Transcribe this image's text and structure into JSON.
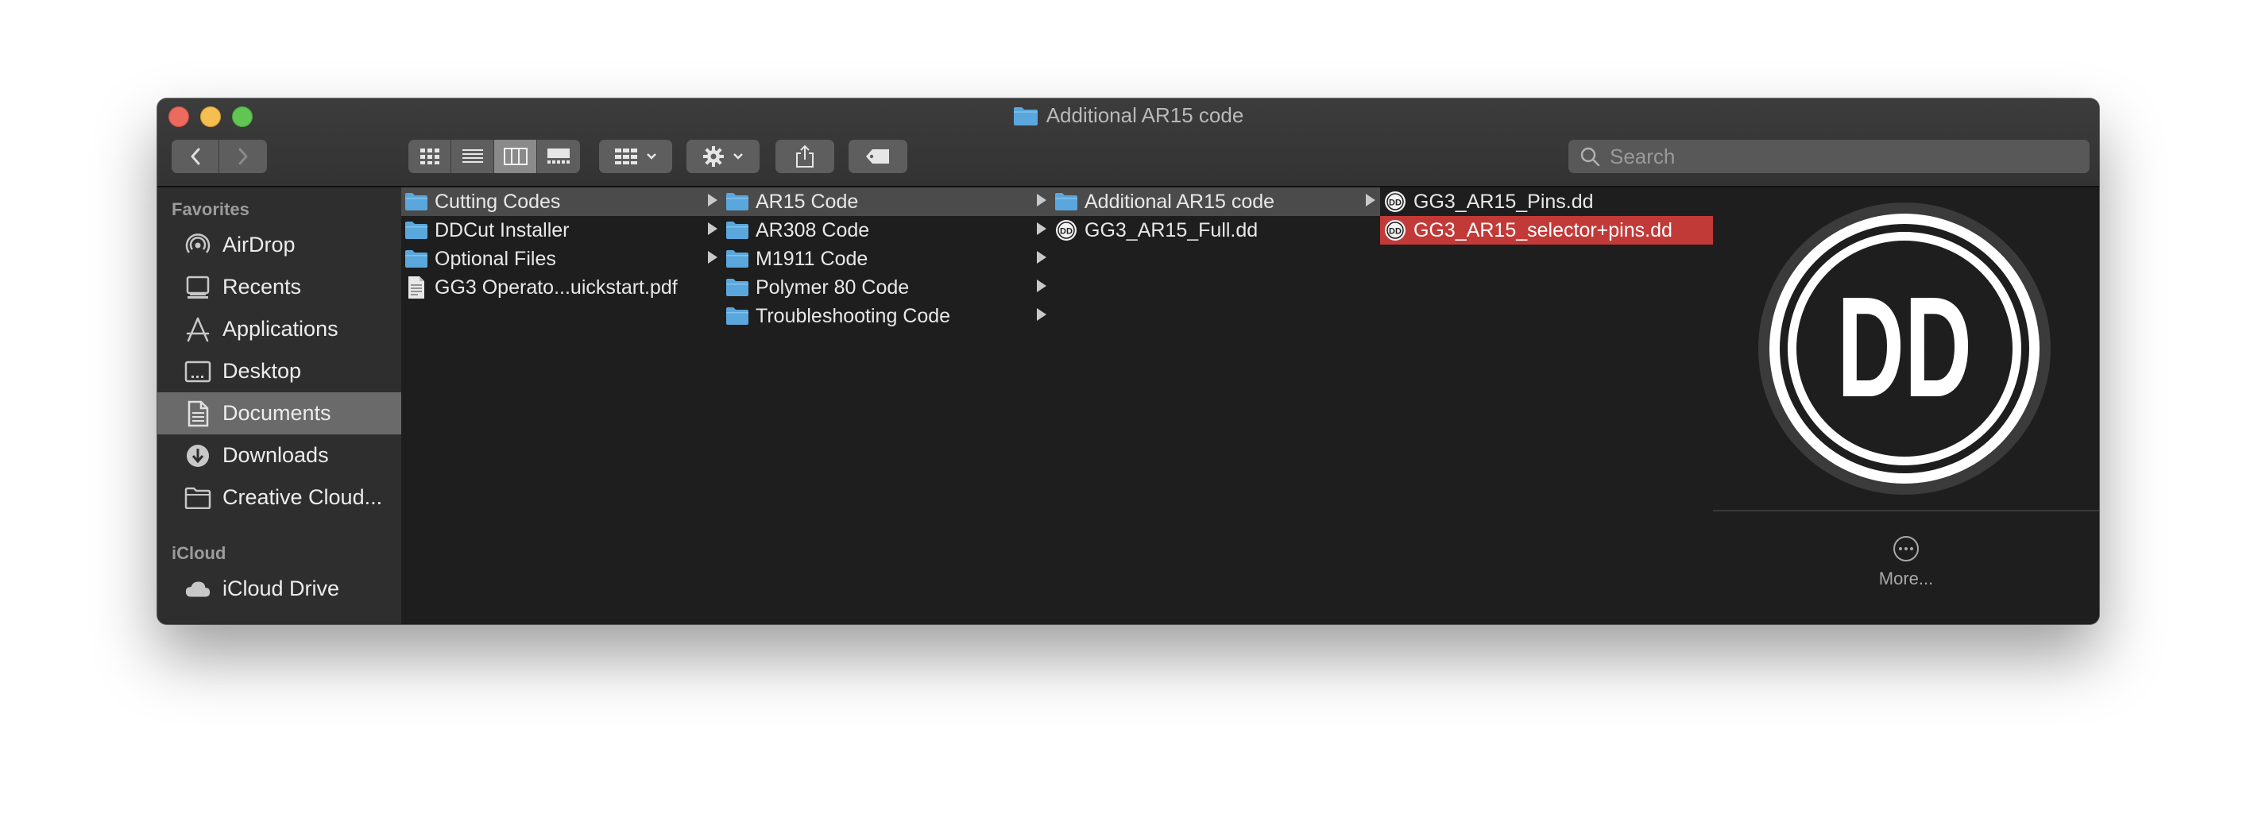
{
  "window": {
    "title": "Additional AR15 code"
  },
  "toolbar": {
    "search_placeholder": "Search"
  },
  "sidebar": {
    "favorites_header": "Favorites",
    "favorites": [
      {
        "label": "AirDrop",
        "icon": "airdrop-icon"
      },
      {
        "label": "Recents",
        "icon": "recents-icon"
      },
      {
        "label": "Applications",
        "icon": "applications-icon"
      },
      {
        "label": "Desktop",
        "icon": "desktop-icon"
      },
      {
        "label": "Documents",
        "icon": "documents-icon",
        "selected": true
      },
      {
        "label": "Downloads",
        "icon": "downloads-icon"
      },
      {
        "label": "Creative Cloud...",
        "icon": "folder-icon"
      }
    ],
    "icloud_header": "iCloud",
    "icloud": [
      {
        "label": "iCloud Drive",
        "icon": "cloud-icon"
      }
    ]
  },
  "columns": [
    {
      "items": [
        {
          "label": "Cutting Codes",
          "type": "folder",
          "state": "path"
        },
        {
          "label": "DDCut Installer",
          "type": "folder"
        },
        {
          "label": "Optional Files",
          "type": "folder"
        },
        {
          "label": "GG3 Operato...uickstart.pdf",
          "type": "pdf"
        }
      ]
    },
    {
      "items": [
        {
          "label": "AR15 Code",
          "type": "folder",
          "state": "path"
        },
        {
          "label": "AR308 Code",
          "type": "folder"
        },
        {
          "label": "M1911 Code",
          "type": "folder"
        },
        {
          "label": "Polymer 80 Code",
          "type": "folder"
        },
        {
          "label": "Troubleshooting Code",
          "type": "folder"
        }
      ]
    },
    {
      "items": [
        {
          "label": "Additional AR15 code",
          "type": "folder",
          "state": "path"
        },
        {
          "label": "GG3_AR15_Full.dd",
          "type": "dd"
        }
      ]
    },
    {
      "items": [
        {
          "label": "GG3_AR15_Pins.dd",
          "type": "dd"
        },
        {
          "label": "GG3_AR15_selector+pins.dd",
          "type": "dd",
          "state": "selected"
        }
      ]
    }
  ],
  "preview": {
    "logo_text": "DD",
    "more_label": "More..."
  },
  "colors": {
    "selection": "#c23a38",
    "path_highlight": "#4b4b4b",
    "folder": "#5aa7dd",
    "sidebar_active": "#6a6a6a"
  }
}
